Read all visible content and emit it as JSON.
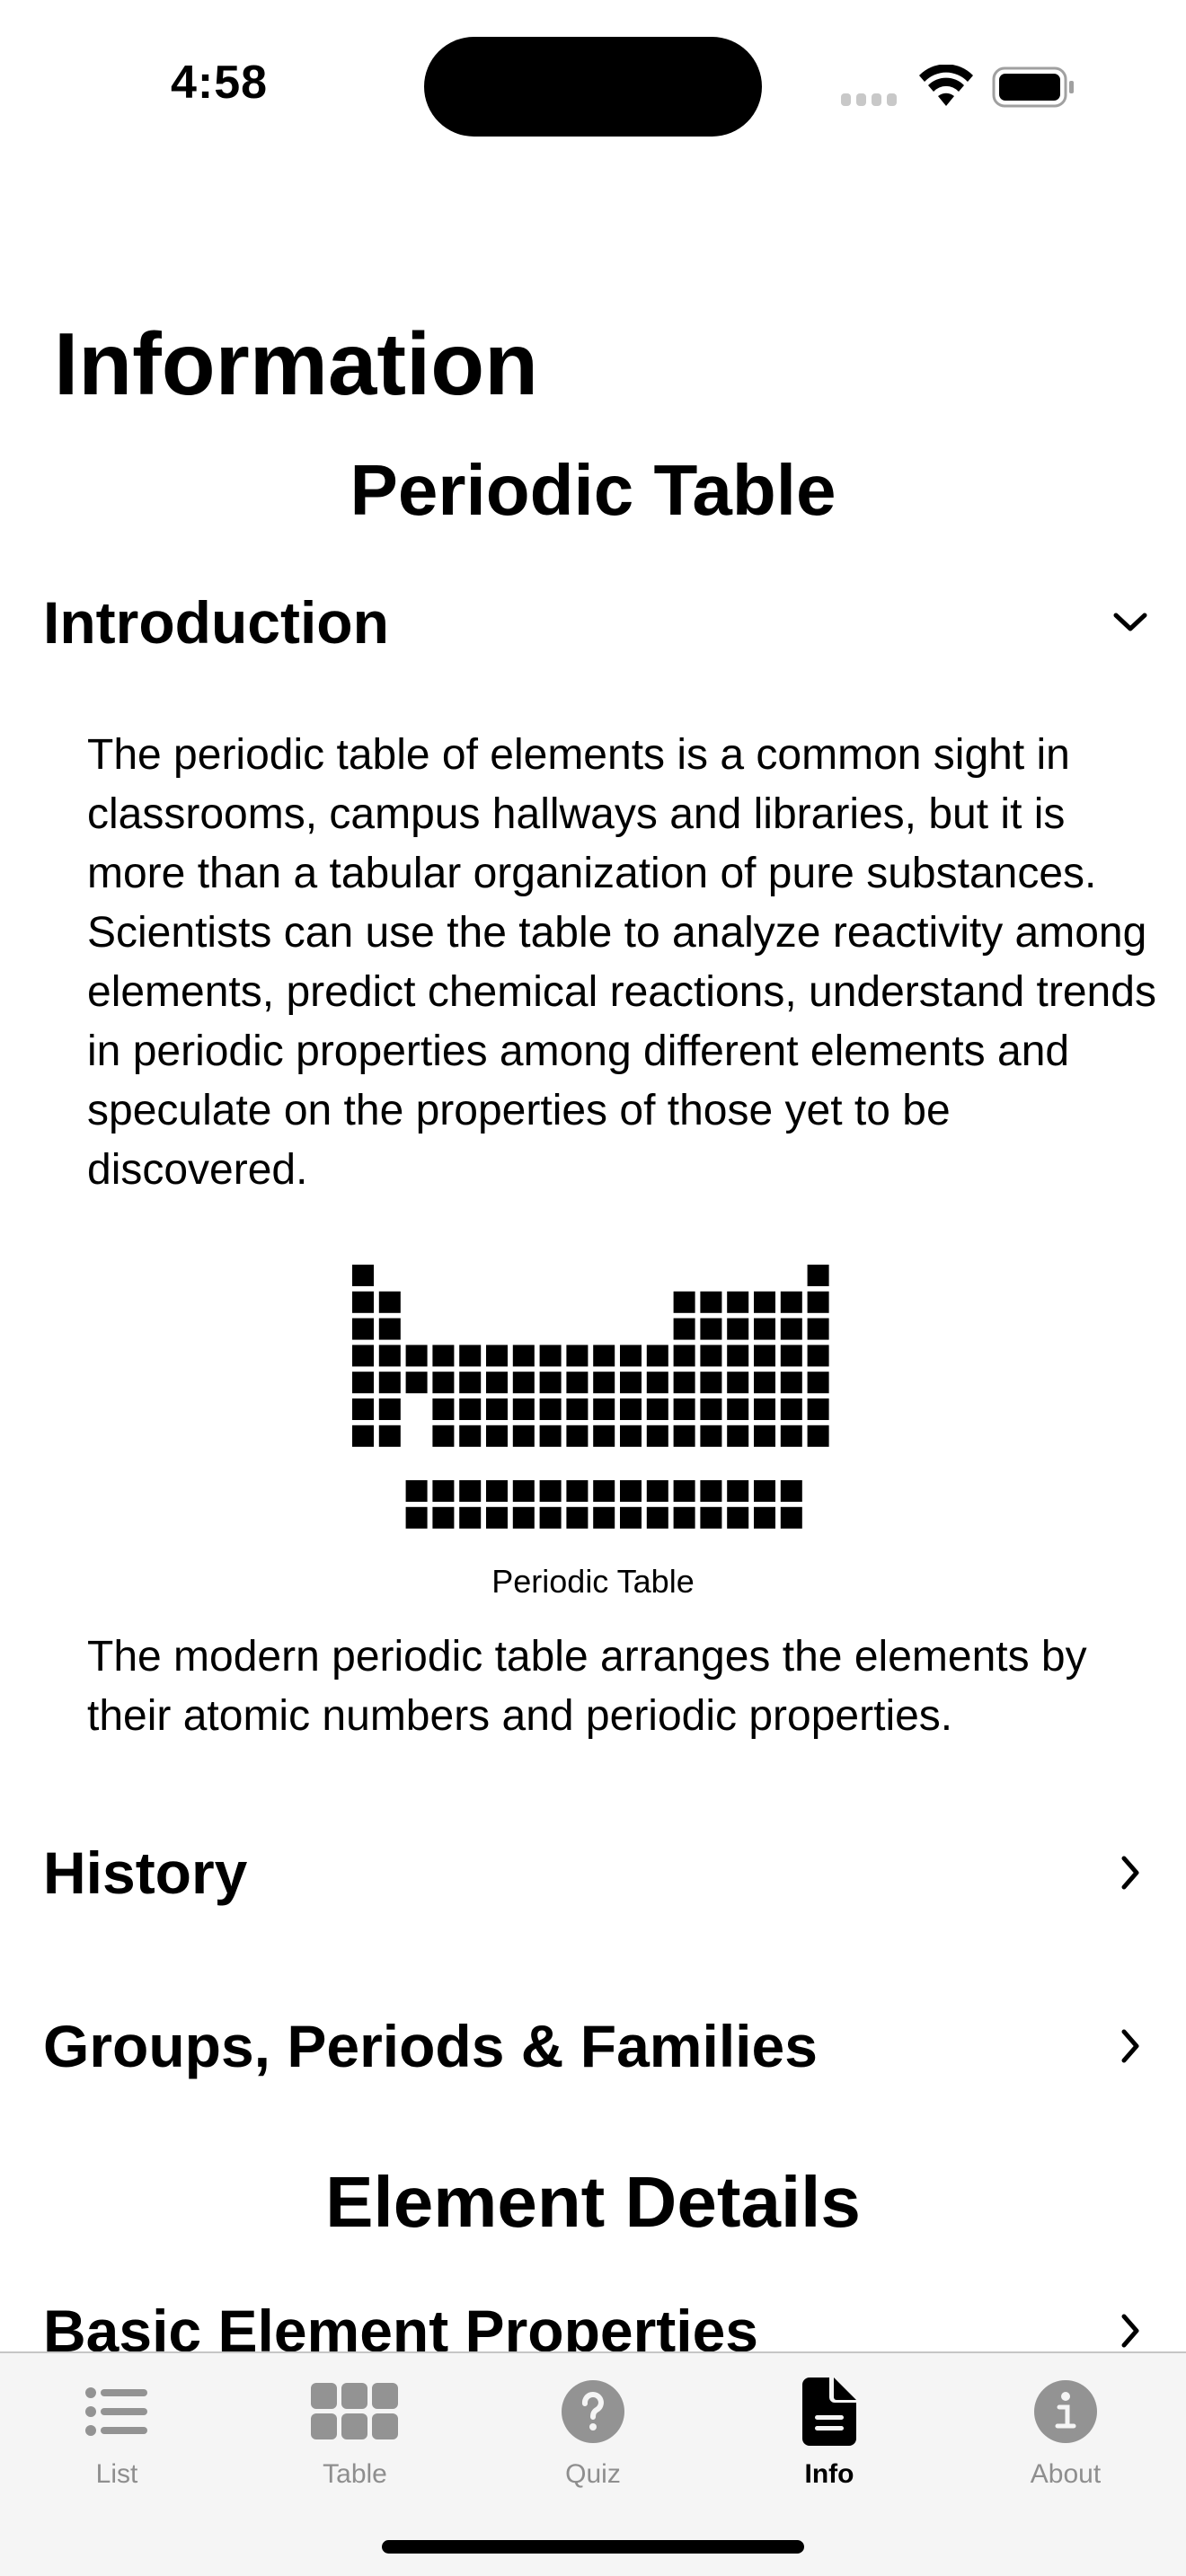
{
  "status_bar": {
    "time": "4:58",
    "icons": [
      "cellular-signal-icon",
      "wifi-icon",
      "battery-icon"
    ]
  },
  "page": {
    "title": "Information",
    "sections": [
      {
        "heading": "Periodic Table",
        "items": [
          {
            "label": "Introduction",
            "expanded": true,
            "chevron": "chevron-down-icon",
            "paragraph_1": "The periodic table of elements is a common sight in classrooms, campus hallways and libraries, but it is more than a tabular organization of pure substances. Scientists can use the table to analyze reactivity among elements, predict chemical reactions, understand trends in periodic properties among different elements and speculate on the properties of those yet to be discovered.",
            "figure_caption": "Periodic Table",
            "paragraph_2": "The modern periodic table arranges the elements by their atomic numbers and periodic properties."
          },
          {
            "label": "History",
            "expanded": false,
            "chevron": "chevron-right-icon"
          },
          {
            "label": "Groups, Periods & Families",
            "expanded": false,
            "chevron": "chevron-right-icon"
          }
        ]
      },
      {
        "heading": "Element Details",
        "items": [
          {
            "label": "Basic Element Properties",
            "expanded": false,
            "chevron": "chevron-right-icon"
          }
        ]
      }
    ]
  },
  "tab_bar": {
    "tabs": [
      {
        "label": "List",
        "icon": "list-icon",
        "active": false
      },
      {
        "label": "Table",
        "icon": "grid-icon",
        "active": false
      },
      {
        "label": "Quiz",
        "icon": "question-circle-icon",
        "active": false
      },
      {
        "label": "Info",
        "icon": "document-icon",
        "active": true
      },
      {
        "label": "About",
        "icon": "info-circle-icon",
        "active": false
      }
    ]
  },
  "colors": {
    "text": "#000000",
    "inactive_tab": "#8e8e8e",
    "tab_bar_bg": "#f5f5f5"
  }
}
